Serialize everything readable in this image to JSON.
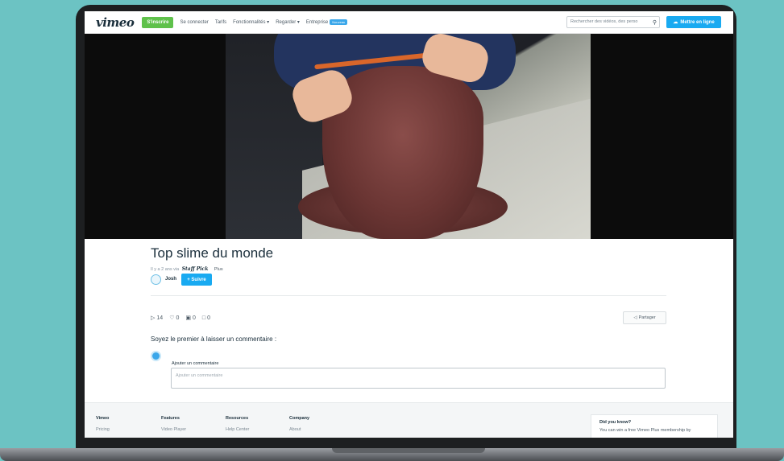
{
  "navbar": {
    "logo": "vimeo",
    "signup_label": "S'inscrire",
    "links": [
      "Se connecter",
      "Tarifs",
      "Fonctionnalités ▾",
      "Regarder ▾",
      "Entreprise"
    ],
    "badge": "Nouveau",
    "search_placeholder": "Rechercher des vidéos, des perso",
    "upload_label": "Mettre en ligne"
  },
  "video": {
    "title": "Top slime du monde",
    "meta": "Il y a 2 ans via",
    "meta_badge": "Staff Pick",
    "meta_plus": "Plus",
    "author": "Josh",
    "follow_label": "+ Suivre"
  },
  "stats": {
    "plays": "14",
    "likes": "0",
    "collections": "0",
    "comments": "0",
    "share_label": "Partager"
  },
  "comments": {
    "heading": "Soyez le premier à laisser un commentaire :",
    "label": "Ajouter un commentaire",
    "placeholder": "Ajouter un commentaire"
  },
  "footer": {
    "columns": [
      {
        "heading": "Vimeo",
        "link": "Pricing"
      },
      {
        "heading": "Features",
        "link": "Video Player"
      },
      {
        "heading": "Resources",
        "link": "Help Center"
      },
      {
        "heading": "Company",
        "link": "About"
      }
    ],
    "promo_heading": "Did you know?",
    "promo_text": "You can win a free Vimeo Plus membership by"
  },
  "colors": {
    "accent": "#19aaf1",
    "signup": "#5fc14b",
    "background": "#6cc3c3"
  }
}
